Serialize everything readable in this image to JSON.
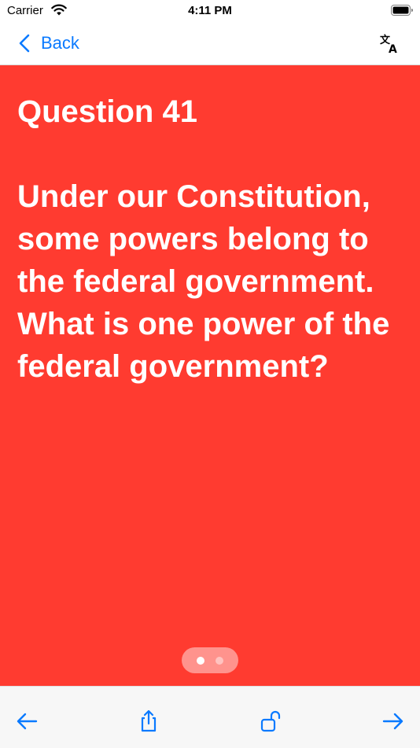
{
  "status_bar": {
    "carrier": "Carrier",
    "time": "4:11 PM"
  },
  "nav": {
    "back_label": "Back"
  },
  "card": {
    "title": "Question 41",
    "question": "Under our Constitution, some powers belong to the federal government. What is one power of the federal government?",
    "color": "#ff3b30",
    "page_count": 2,
    "active_page": 1
  },
  "toolbar": {
    "icons": [
      "arrow-left-icon",
      "share-icon",
      "unlock-icon",
      "arrow-right-icon"
    ]
  },
  "colors": {
    "accent": "#0a7aff",
    "card": "#ff3b30"
  }
}
